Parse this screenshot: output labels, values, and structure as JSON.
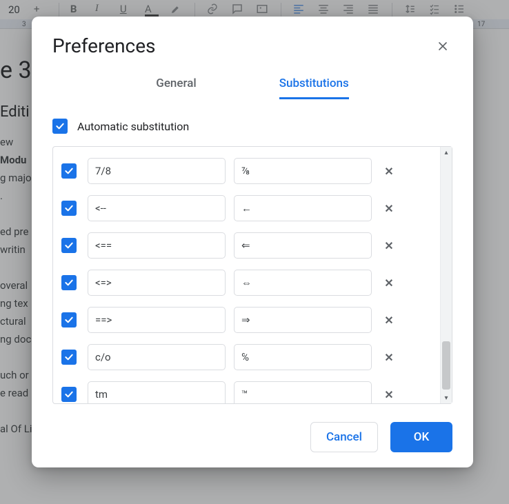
{
  "toolbar": {
    "font_size": "20",
    "ruler_left_mark": "3",
    "ruler_right_mark": "17"
  },
  "document": {
    "heading_fragment": "e 3:",
    "subheading_fragment": "Editi",
    "lines": [
      "ew",
      "Modu",
      "g majo",
      ".",
      "",
      "ed pre",
      " writin",
      "",
      "overal",
      "ng tex",
      "ctural ",
      "ng doc",
      "",
      "uch or",
      "e read",
      "",
      "al Of Line Editing"
    ]
  },
  "dialog": {
    "title": "Preferences",
    "tabs": {
      "general": "General",
      "substitutions": "Substitutions"
    },
    "auto_label": "Automatic substitution",
    "substitutions": [
      {
        "from": "7/8",
        "to": "⅞"
      },
      {
        "from": "<--",
        "to": "←"
      },
      {
        "from": "<==",
        "to": "⇐"
      },
      {
        "from": "<=>",
        "to": "⇔"
      },
      {
        "from": "==>",
        "to": "⇒"
      },
      {
        "from": "c/o",
        "to": "℅"
      },
      {
        "from": "tm",
        "to": "™"
      }
    ],
    "buttons": {
      "cancel": "Cancel",
      "ok": "OK"
    },
    "row_delete_glyph": "✕",
    "scroll_up_glyph": "▴",
    "scroll_down_glyph": "▾"
  }
}
